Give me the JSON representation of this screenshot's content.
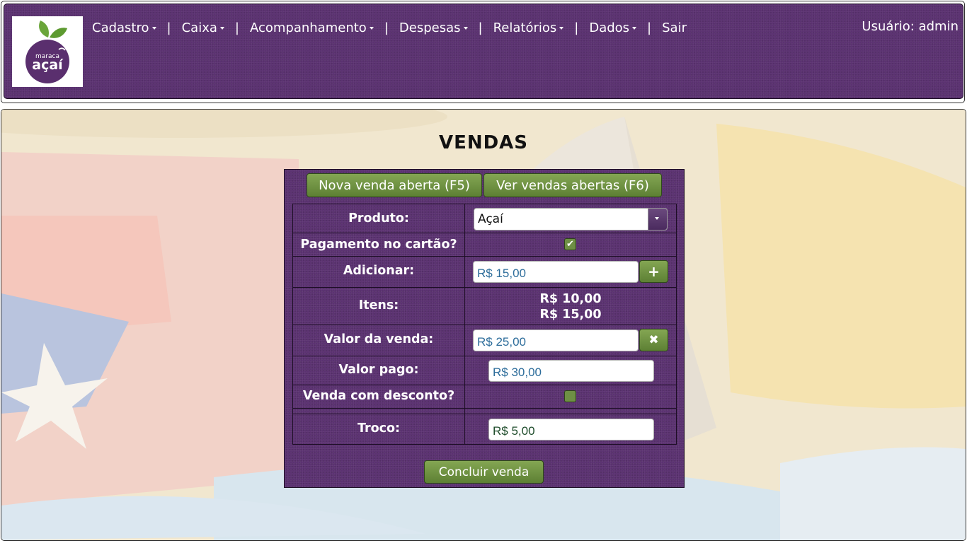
{
  "header": {
    "logo": {
      "alt": "Maraca Açaí",
      "line1": "maraca",
      "line2": "açaí"
    },
    "nav": [
      {
        "label": "Cadastro",
        "has_dropdown": true
      },
      {
        "label": "Caixa",
        "has_dropdown": true
      },
      {
        "label": "Acompanhamento",
        "has_dropdown": true
      },
      {
        "label": "Despesas",
        "has_dropdown": true
      },
      {
        "label": "Relatórios",
        "has_dropdown": true
      },
      {
        "label": "Dados",
        "has_dropdown": true
      },
      {
        "label": "Sair",
        "has_dropdown": false
      }
    ],
    "separator": "|",
    "user": "Usuário: admin"
  },
  "page": {
    "title": "VENDAS"
  },
  "actions": {
    "new_sale": "Nova venda aberta (F5)",
    "view_open_sales": "Ver vendas abertas (F6)",
    "finish_sale": "Concluir venda"
  },
  "form": {
    "product": {
      "label": "Produto:",
      "value": "Açaí"
    },
    "card_payment": {
      "label": "Pagamento no cartão?",
      "checked": true
    },
    "add": {
      "label": "Adicionar:",
      "value": "R$ 15,00",
      "button_icon": "plus-icon"
    },
    "items": {
      "label": "Itens:",
      "values": [
        "R$ 10,00",
        "R$ 15,00"
      ]
    },
    "sale_value": {
      "label": "Valor da venda:",
      "value": "R$ 25,00",
      "button_icon": "remove-icon"
    },
    "paid_value": {
      "label": "Valor pago:",
      "value": "R$ 30,00"
    },
    "discount": {
      "label": "Venda com desconto?",
      "checked": false
    },
    "change": {
      "label": "Troco:",
      "value": "R$ 5,00"
    }
  },
  "colors": {
    "header_purple": "#5b3271",
    "button_green": "#6e8f45",
    "input_text_blue": "#2d6d9b"
  }
}
